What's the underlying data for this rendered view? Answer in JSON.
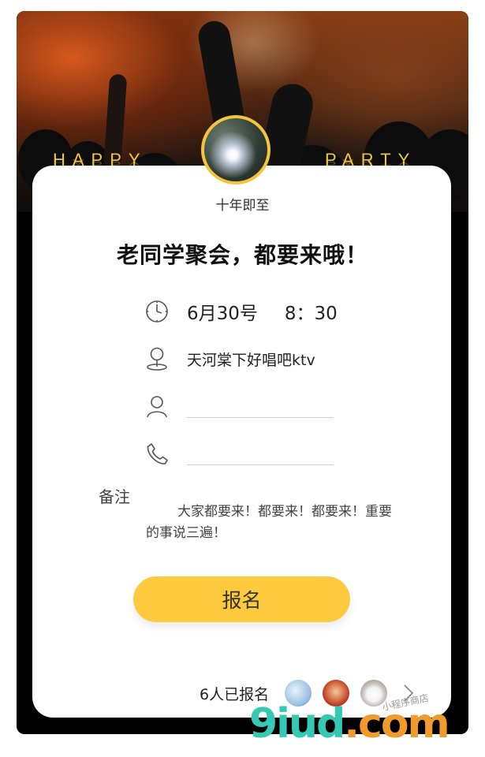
{
  "hero": {
    "left_word": "HAPPY",
    "right_word": "PARTY"
  },
  "host": {
    "name": "十年即至"
  },
  "event": {
    "title": "老同学聚会，都要来哦！",
    "date": "6月30号",
    "time": "8：30",
    "place": "天河棠下好唱吧ktv"
  },
  "form": {
    "name_value": "",
    "phone_value": ""
  },
  "remark": {
    "label": "备注",
    "text": "大家都要来！都要来！都要来！重要的事说三遍！"
  },
  "signup_button": {
    "label": "报名"
  },
  "footer": {
    "count_text": "6人已报名"
  },
  "watermark": {
    "brand": "9iud",
    "tld": ".com",
    "tagline": "小程序商店"
  },
  "colors": {
    "accent": "#fdca3d",
    "gold_text": "#f2c53d",
    "watermark_teal": "#33c9b4",
    "watermark_orange": "#f39a2d"
  }
}
